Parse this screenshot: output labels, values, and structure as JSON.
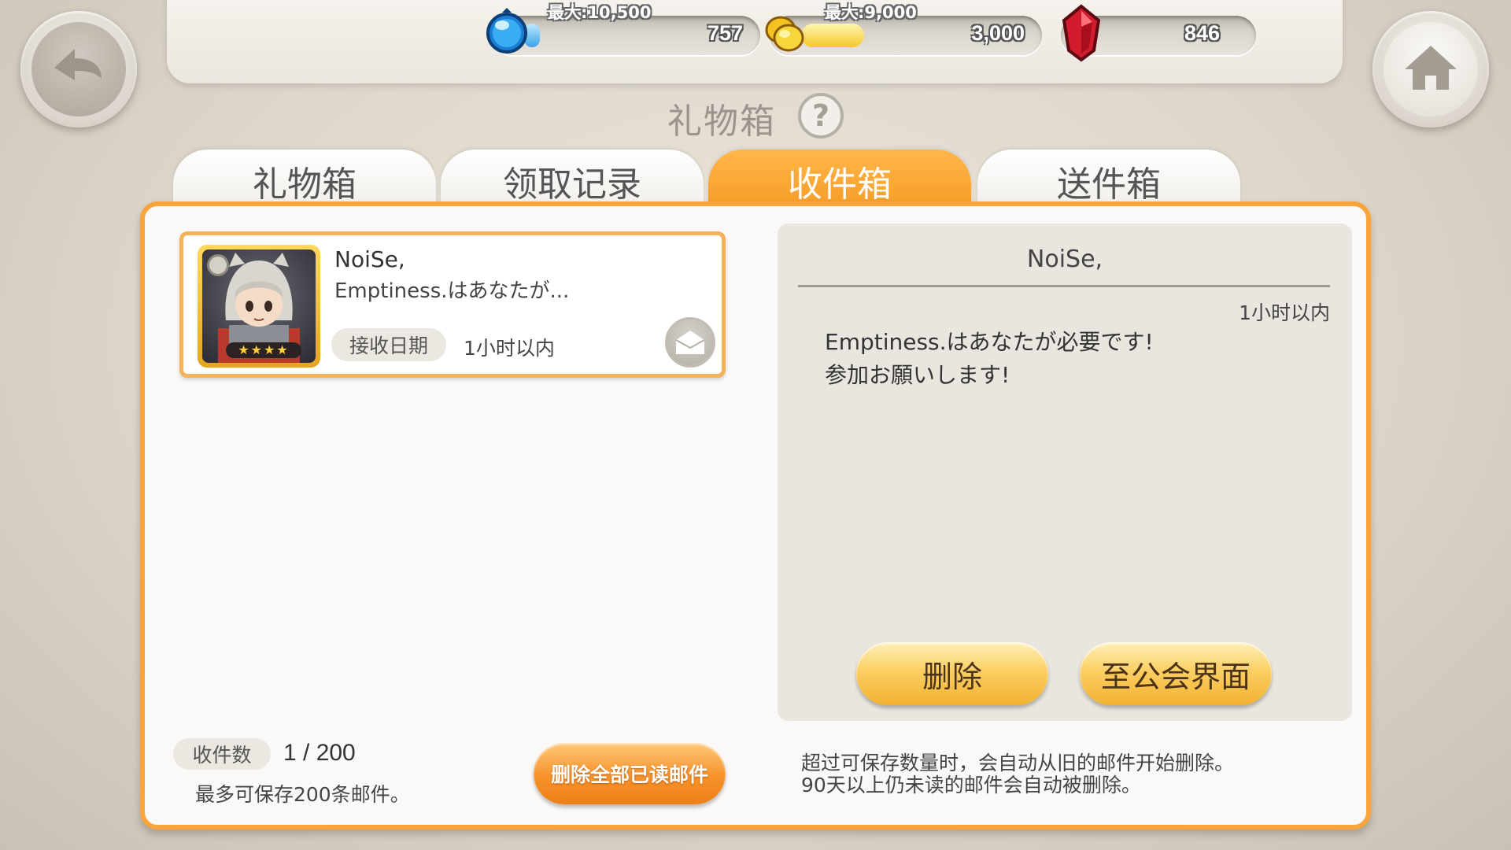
{
  "header": {
    "currencies": [
      {
        "name": "blue-orb",
        "max_label": "最大:10,500",
        "value": "757",
        "fill_fraction": 0.07
      },
      {
        "name": "gold-coin",
        "max_label": "最大:9,000",
        "value": "3,000",
        "fill_fraction": 0.33
      },
      {
        "name": "red-gem",
        "max_label": "",
        "value": "846"
      }
    ],
    "back_icon": "back-arrow-icon",
    "home_icon": "home-icon"
  },
  "page": {
    "title": "礼物箱",
    "help_glyph": "?"
  },
  "tabs": [
    {
      "label": "礼物箱",
      "active": false
    },
    {
      "label": "领取记录",
      "active": false
    },
    {
      "label": "收件箱",
      "active": true
    },
    {
      "label": "送件箱",
      "active": false
    }
  ],
  "mail_list": [
    {
      "sender": "NoiSe,",
      "preview": "Emptiness.はあなたが...",
      "date_label": "接收日期",
      "date_value": "1小时以内",
      "stars": "★★★★"
    }
  ],
  "footer_left": {
    "count_label": "收件数",
    "count_value": "1 / 200",
    "note": "最多可保存200条邮件。",
    "delete_all_label": "删除全部已读邮件"
  },
  "detail": {
    "sender": "NoiSe,",
    "time": "1小时以内",
    "body_line1": "Emptiness.はあなたが必要です!",
    "body_line2": "参加お願いします!",
    "delete_label": "删除",
    "guild_label": "至公会界面"
  },
  "footer_right": {
    "note_line1": "超过可保存数量时，会自动从旧的邮件开始删除。",
    "note_line2": "90天以上仍未读的邮件会自动被删除。"
  },
  "colors": {
    "accent_orange": "#f8a43a",
    "button_yellow": "#fbcf63"
  }
}
